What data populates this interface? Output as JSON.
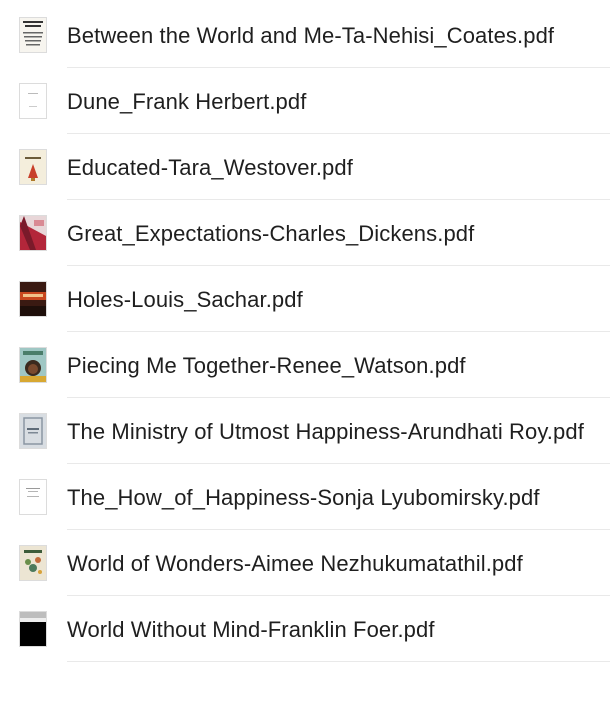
{
  "files": [
    {
      "name": "Between the World and Me-Ta-Nehisi_Coates.pdf",
      "thumb_icon": "pdf-cover-coates-icon"
    },
    {
      "name": "Dune_Frank Herbert.pdf",
      "thumb_icon": "pdf-cover-dune-icon"
    },
    {
      "name": "Educated-Tara_Westover.pdf",
      "thumb_icon": "pdf-cover-educated-icon"
    },
    {
      "name": "Great_Expectations-Charles_Dickens.pdf",
      "thumb_icon": "pdf-cover-great-expectations-icon"
    },
    {
      "name": "Holes-Louis_Sachar.pdf",
      "thumb_icon": "pdf-cover-holes-icon"
    },
    {
      "name": "Piecing Me Together-Renee_Watson.pdf",
      "thumb_icon": "pdf-cover-piecing-icon"
    },
    {
      "name": "The Ministry of Utmost Happiness-Arundhati Roy.pdf",
      "thumb_icon": "pdf-cover-ministry-icon"
    },
    {
      "name": "The_How_of_Happiness-Sonja Lyubomirsky.pdf",
      "thumb_icon": "pdf-cover-how-of-happiness-icon"
    },
    {
      "name": "World of Wonders-Aimee Nezhukumatathil.pdf",
      "thumb_icon": "pdf-cover-world-of-wonders-icon"
    },
    {
      "name": "World Without Mind-Franklin Foer.pdf",
      "thumb_icon": "pdf-cover-world-without-mind-icon"
    }
  ]
}
